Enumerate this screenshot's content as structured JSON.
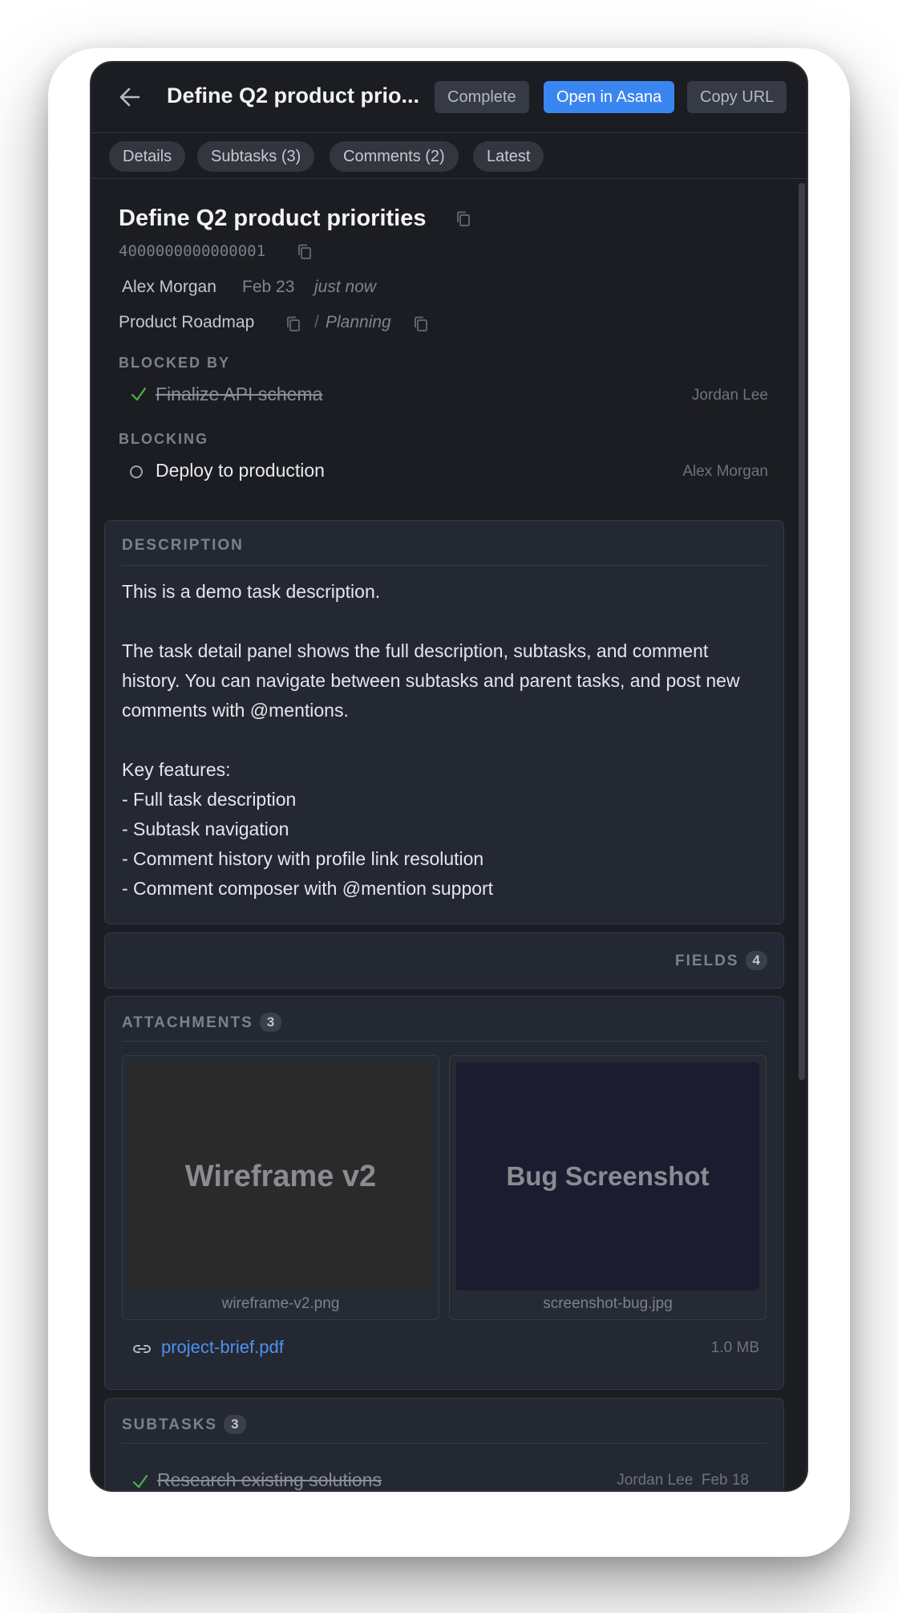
{
  "header": {
    "title": "Define Q2 product prio...",
    "complete_label": "Complete",
    "open_label": "Open in Asana",
    "copy_url_label": "Copy URL"
  },
  "tabs": [
    {
      "label": "Details"
    },
    {
      "label": "Subtasks (3)"
    },
    {
      "label": "Comments (2)"
    },
    {
      "label": "Latest"
    }
  ],
  "task": {
    "title": "Define Q2 product priorities",
    "id": "4000000000000001",
    "author": "Alex Morgan",
    "date": "Feb 23",
    "relative": "just now",
    "project": "Product Roadmap",
    "separator": "/",
    "section": "Planning"
  },
  "blocked_by": {
    "label": "BLOCKED BY",
    "items": [
      {
        "name": "Finalize API schema",
        "assignee": "Jordan Lee",
        "done": true
      }
    ]
  },
  "blocking": {
    "label": "BLOCKING",
    "items": [
      {
        "name": "Deploy to production",
        "assignee": "Alex Morgan",
        "done": false
      }
    ]
  },
  "description": {
    "label": "DESCRIPTION",
    "text": "This is a demo task description.\n\nThe task detail panel shows the full description, subtasks, and comment history. You can navigate between subtasks and parent tasks, and post new comments with @mentions.\n\nKey features:\n- Full task description\n- Subtask navigation\n- Comment history with profile link resolution\n- Comment composer with @mention support"
  },
  "fields": {
    "label": "FIELDS",
    "count": "4"
  },
  "attachments": {
    "label": "ATTACHMENTS",
    "count": "3",
    "images": [
      {
        "preview_text": "Wireframe v2",
        "filename": "wireframe-v2.png",
        "bg": "#2a2a2a"
      },
      {
        "preview_text": "Bug Screenshot",
        "filename": "screenshot-bug.jpg",
        "bg": "#1c1c30"
      }
    ],
    "file": {
      "name": "project-brief.pdf",
      "size": "1.0 MB"
    }
  },
  "subtasks": {
    "label": "SUBTASKS",
    "count": "3",
    "items": [
      {
        "name": "Research existing solutions",
        "assignee": "Jordan Lee",
        "date": "Feb 18",
        "done": true
      }
    ]
  },
  "colors": {
    "accent": "#3a86f0",
    "check": "#4caf50",
    "link": "#4e91f2",
    "background": "#1c1d22"
  },
  "icons": {
    "back": "arrow-left-icon",
    "copy": "copy-icon",
    "check": "check-icon",
    "link": "link-icon"
  }
}
